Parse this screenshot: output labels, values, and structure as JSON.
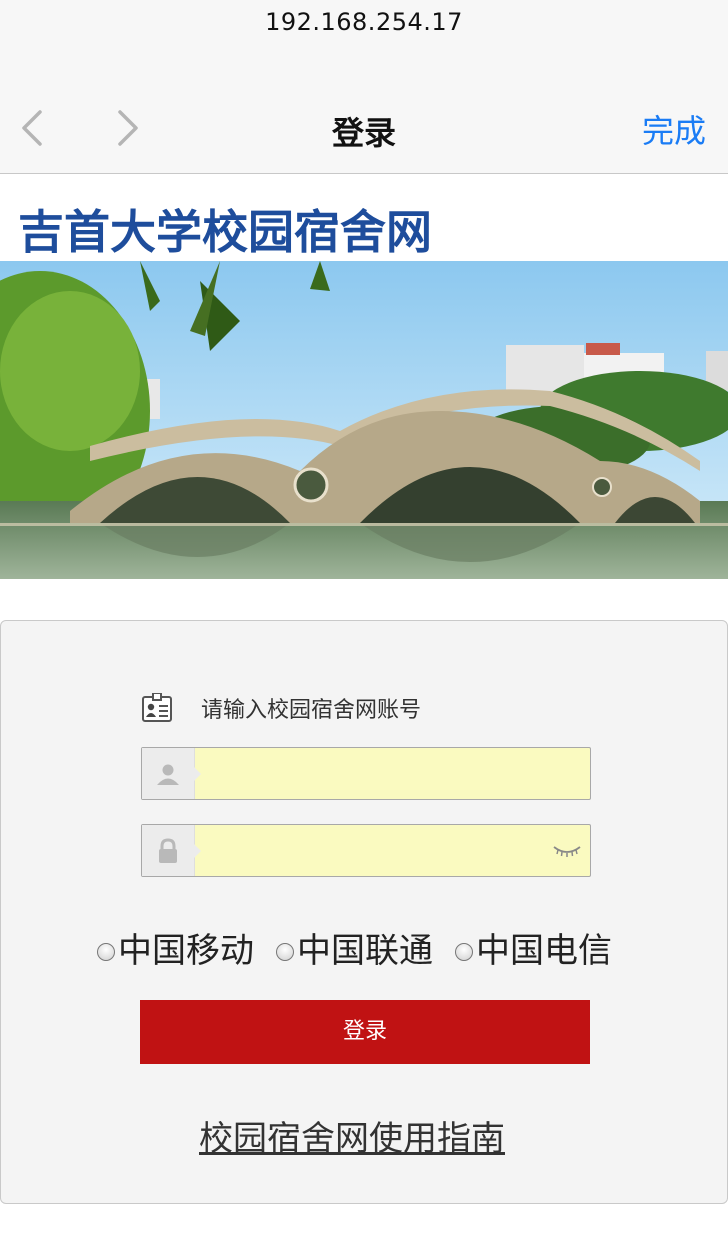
{
  "browser": {
    "url": "192.168.254.17",
    "title": "登录",
    "done_label": "完成",
    "back_icon": "chevron-left-icon",
    "forward_icon": "chevron-right-icon"
  },
  "site": {
    "title": "吉首大学校园宿舍网",
    "brand_color": "#1e4d9c"
  },
  "login": {
    "prompt": "请输入校园宿舍网账号",
    "username": {
      "value": "",
      "placeholder": "",
      "icon": "user-icon"
    },
    "password": {
      "value": "",
      "placeholder": "",
      "icon": "lock-icon",
      "toggle_icon": "eye-closed-icon"
    },
    "field_bg_color": "#fafac0",
    "carriers": [
      {
        "label": "中国移动",
        "selected": false
      },
      {
        "label": "中国联通",
        "selected": false
      },
      {
        "label": "中国电信",
        "selected": false
      }
    ],
    "submit_label": "登录",
    "submit_color": "#c01213",
    "guide_link": "校园宿舍网使用指南"
  },
  "accent_color": "#1a7cf5"
}
